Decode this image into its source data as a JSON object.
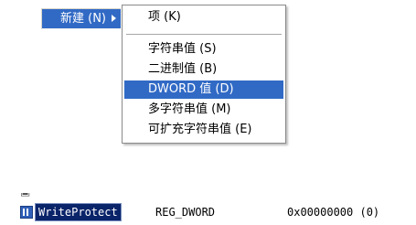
{
  "context_menu": {
    "parent_item": "新建 (N)",
    "submenu": {
      "items": [
        {
          "label": "项 (K)"
        },
        {
          "label": "字符串值 (S)"
        },
        {
          "label": "二进制值 (B)"
        },
        {
          "label": "DWORD 值 (D)",
          "selected": true
        },
        {
          "label": "多字符串值 (M)"
        },
        {
          "label": "可扩充字符串值 (E)"
        }
      ]
    }
  },
  "registry_list": {
    "selected_row": {
      "name": "WriteProtect",
      "type": "REG_DWORD",
      "data": "0x00000000 (0)"
    }
  },
  "colors": {
    "highlight": "#316ac5",
    "selected_row_bg": "#0a246a"
  }
}
